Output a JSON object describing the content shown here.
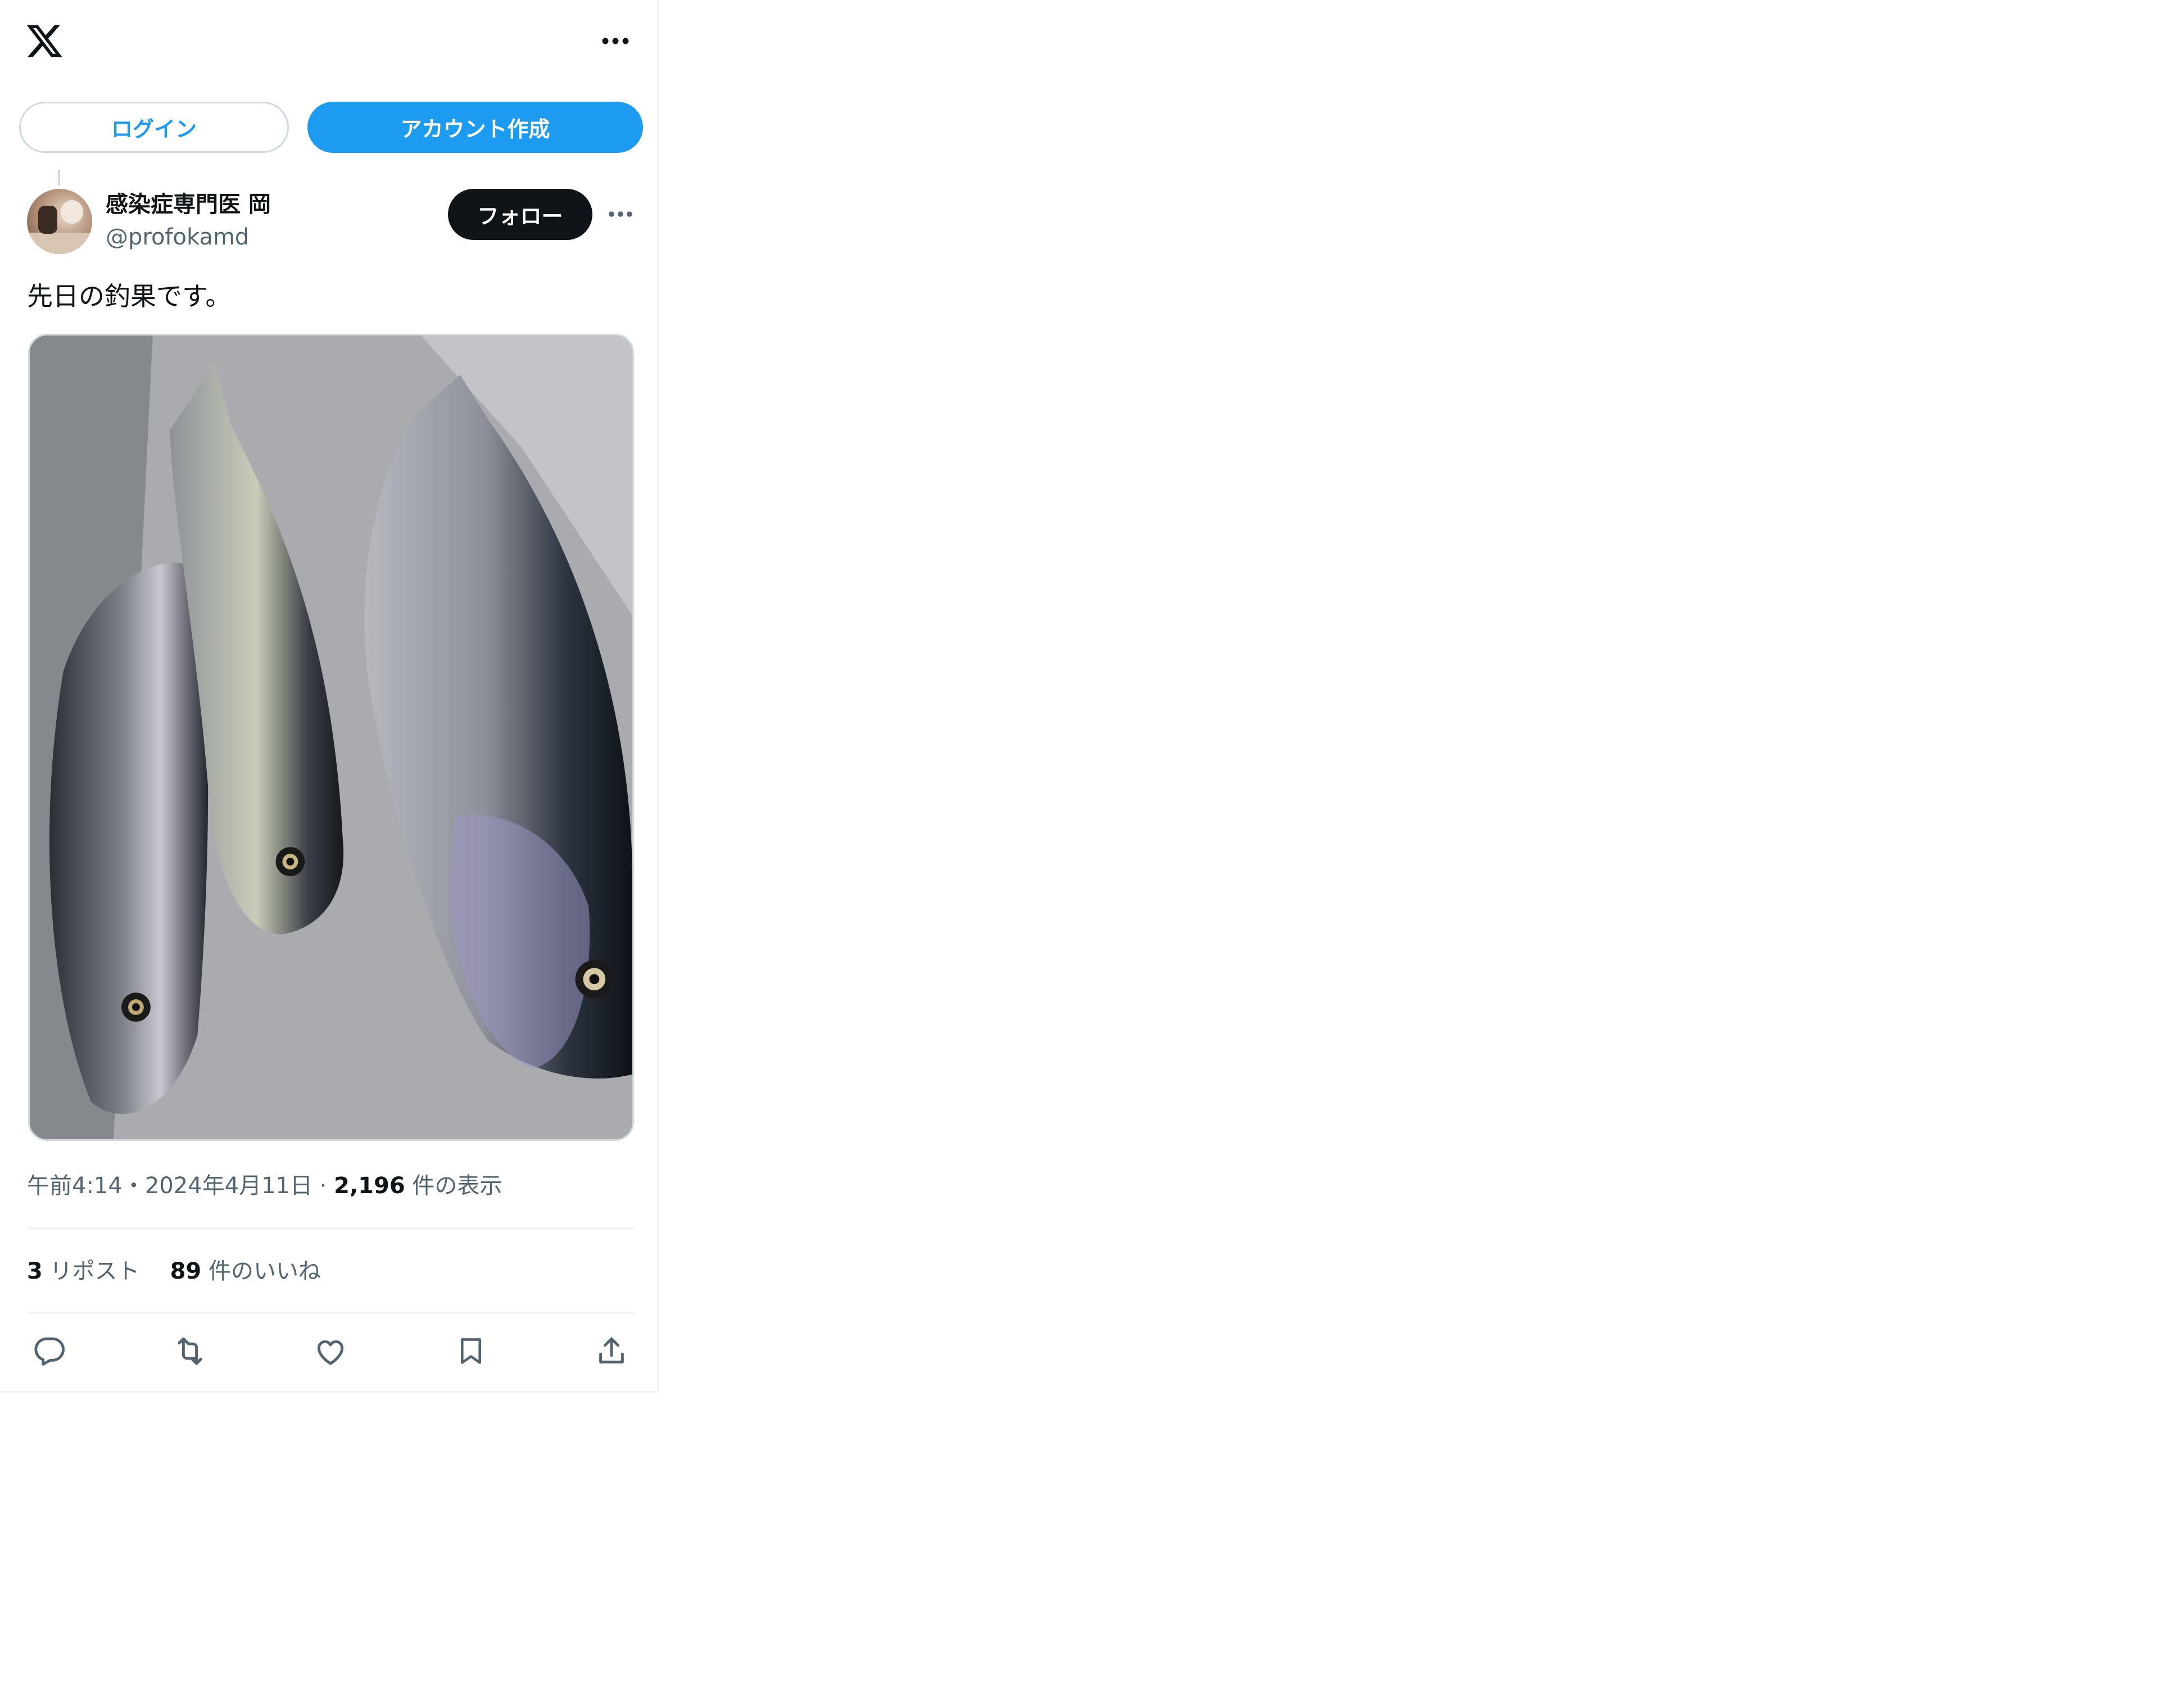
{
  "header": {
    "login_label": "ログイン",
    "signup_label": "アカウント作成"
  },
  "author": {
    "display_name": "感染症専門医 岡",
    "handle": "@profokamd",
    "follow_label": "フォロー"
  },
  "tweet": {
    "text": "先日の釣果です。",
    "media_alt": "Three trout lying in a stainless steel sink"
  },
  "meta": {
    "time": "午前4:14",
    "separator": "・",
    "date": "2024年4月11日",
    "separator2": " · ",
    "views_count": "2,196",
    "views_label": "件の表示"
  },
  "stats": {
    "reposts_count": "3",
    "reposts_label": "リポスト",
    "likes_count": "89",
    "likes_label": "件のいいね"
  },
  "colors": {
    "accent": "#1d9bf0",
    "text": "#0f1419",
    "secondary": "#536471",
    "border": "#cfd9de"
  },
  "icons": [
    "x-logo-icon",
    "more-icon",
    "reply-icon",
    "repost-icon",
    "like-icon",
    "bookmark-icon",
    "share-icon"
  ]
}
